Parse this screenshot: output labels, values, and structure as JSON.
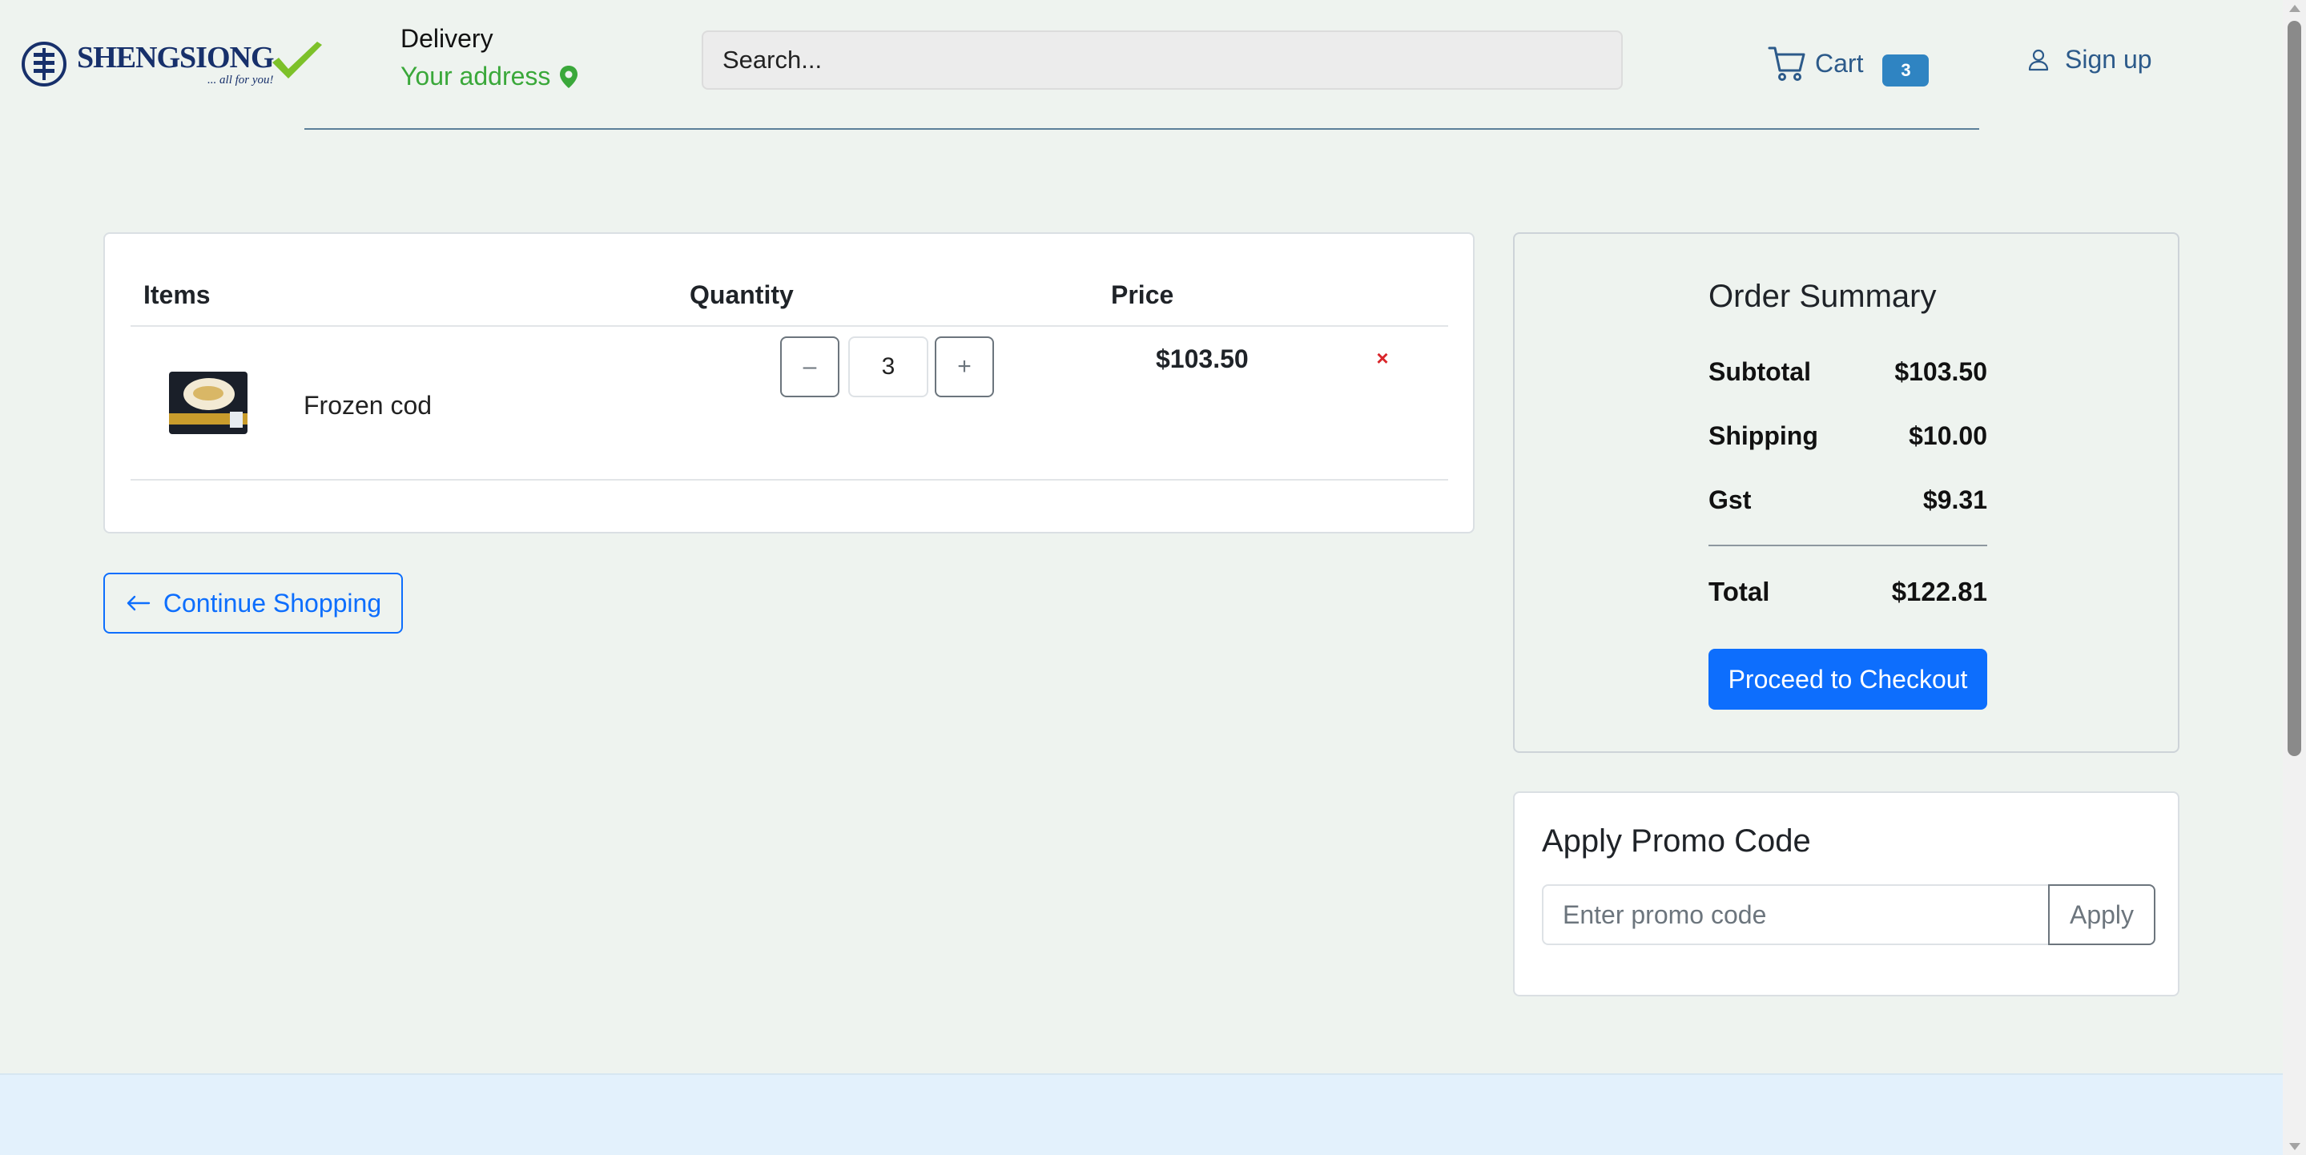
{
  "header": {
    "logo": {
      "name": "SHENGSIONG",
      "tagline": "... all for you!"
    },
    "delivery": {
      "label": "Delivery",
      "address": "Your address"
    },
    "search": {
      "placeholder": "Search..."
    },
    "cart": {
      "label": "Cart",
      "count": "3"
    },
    "signup": {
      "label": "Sign up"
    }
  },
  "cart_table": {
    "columns": {
      "items": "Items",
      "quantity": "Quantity",
      "price": "Price"
    },
    "rows": [
      {
        "name": "Frozen cod",
        "quantity": "3",
        "price": "$103.50",
        "minus": "–",
        "plus": "+",
        "remove": "×"
      }
    ]
  },
  "continue_shopping": {
    "label": "Continue Shopping"
  },
  "order_summary": {
    "title": "Order Summary",
    "subtotal_label": "Subtotal",
    "subtotal": "$103.50",
    "shipping_label": "Shipping",
    "shipping": "$10.00",
    "gst_label": "Gst",
    "gst": "$9.31",
    "total_label": "Total",
    "total": "$122.81",
    "checkout_label": "Proceed to Checkout"
  },
  "promo": {
    "title": "Apply Promo Code",
    "placeholder": "Enter promo code",
    "apply_label": "Apply"
  },
  "colors": {
    "accent": "#0d6efd",
    "link": "#2c5a8a",
    "address": "#3aa83a",
    "badge": "#2f84c2",
    "remove": "#d9252a",
    "background": "#eef3ef",
    "footer": "#e3f1fc"
  },
  "icons": {
    "logo": "shengsiong-emblem-icon",
    "check": "check-icon",
    "location": "location-pin-icon",
    "cart": "shopping-cart-icon",
    "user": "user-icon",
    "back": "arrow-left-icon",
    "remove": "close-icon"
  }
}
